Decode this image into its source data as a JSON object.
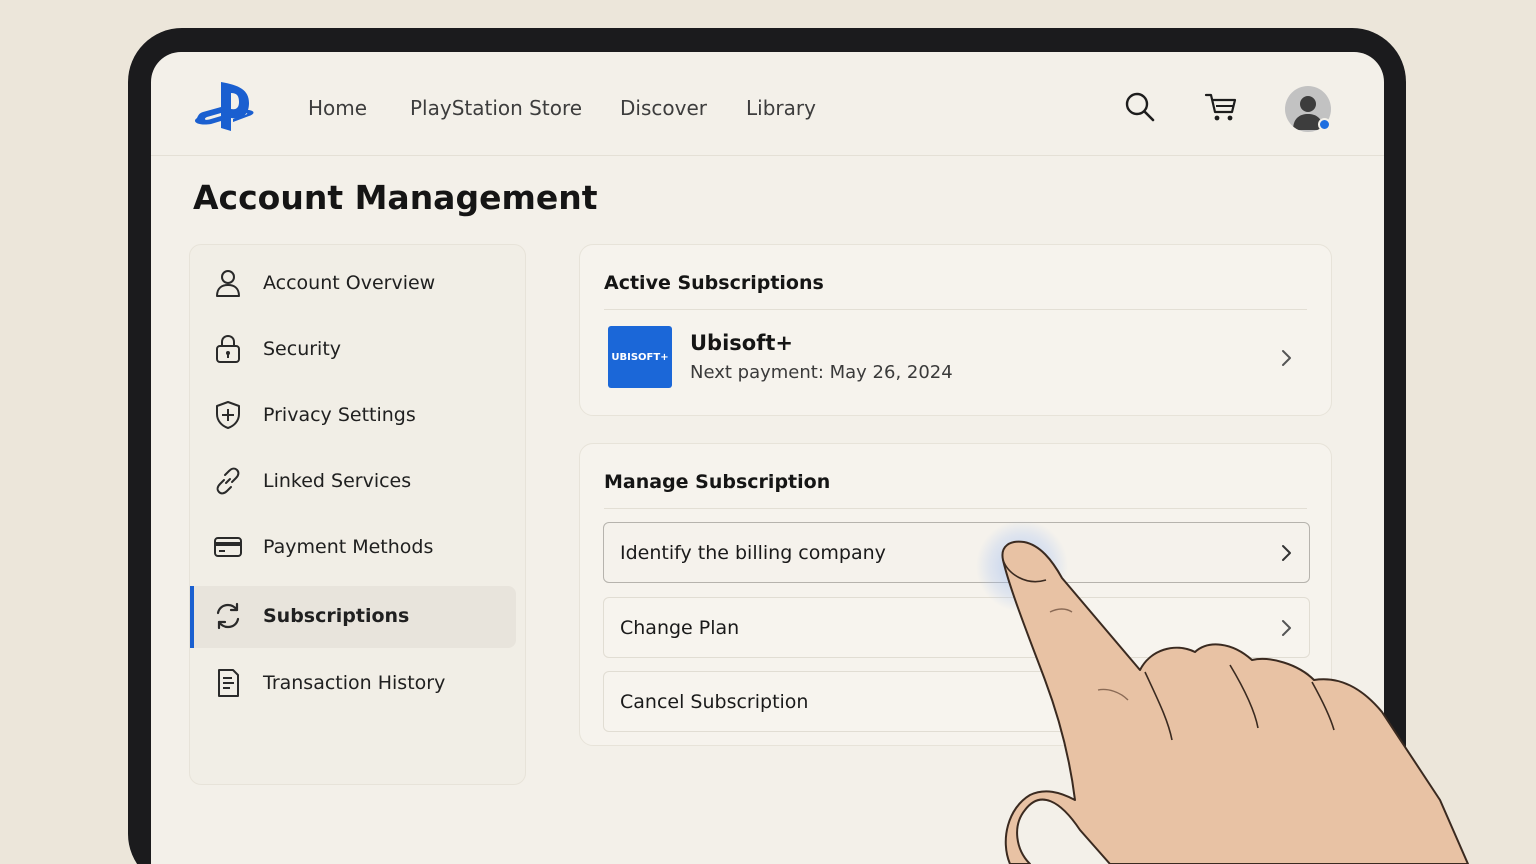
{
  "nav": {
    "links": [
      "Home",
      "PlayStation Store",
      "Discover",
      "Library"
    ],
    "icons": [
      "playstation-logo",
      "search-icon",
      "cart-icon",
      "avatar"
    ]
  },
  "page": {
    "title": "Account Management"
  },
  "sidebar": {
    "items": [
      {
        "label": "Account Overview",
        "icon": "user-icon"
      },
      {
        "label": "Security",
        "icon": "lock-icon"
      },
      {
        "label": "Privacy Settings",
        "icon": "shield-icon"
      },
      {
        "label": "Linked Services",
        "icon": "link-icon"
      },
      {
        "label": "Payment Methods",
        "icon": "credit-card-icon"
      },
      {
        "label": "Subscriptions",
        "icon": "refresh-icon",
        "active": true
      },
      {
        "label": "Transaction History",
        "icon": "receipt-icon"
      }
    ]
  },
  "active_subscriptions": {
    "title": "Active Subscriptions",
    "item": {
      "logo_text": "UBISOFT+",
      "name": "Ubisoft+",
      "next_payment": "Next payment: May 26, 2024"
    }
  },
  "manage": {
    "title": "Manage Subscription",
    "options": [
      {
        "label": "Identify the billing company",
        "selected": true
      },
      {
        "label": "Change Plan"
      },
      {
        "label": "Cancel Subscription"
      }
    ]
  },
  "colors": {
    "accent": "#1a5fd0",
    "brand_blue": "#1b67d8",
    "background": "#f3f0e9"
  }
}
